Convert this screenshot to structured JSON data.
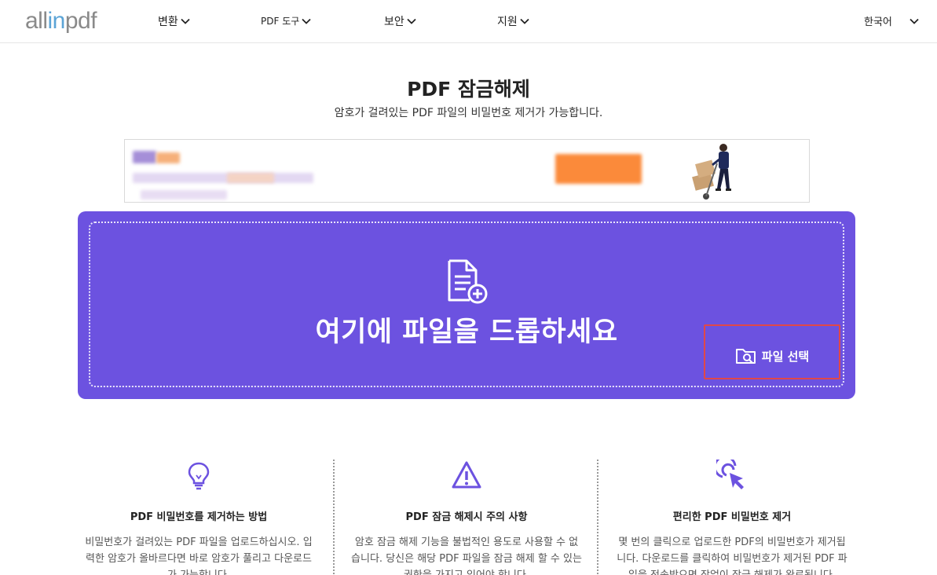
{
  "header": {
    "logo": {
      "pre": "all",
      "mid": "in",
      "post": "pdf"
    },
    "nav": [
      {
        "label": "변환"
      },
      {
        "label": "PDF 도구"
      },
      {
        "label": "보안"
      },
      {
        "label": "지원"
      }
    ],
    "language": "한국어"
  },
  "page": {
    "title": "PDF 잠금해제",
    "subtitle": "암호가 걸려있는 PDF 파일의 비밀번호 제거가 가능합니다."
  },
  "dropzone": {
    "text": "여기에 파일을 드롭하세요",
    "select_label": "파일 선택"
  },
  "features": [
    {
      "icon": "lightbulb-icon",
      "title": "PDF 비밀번호를 제거하는 방법",
      "text": "비밀번호가 걸려있는 PDF 파일을 업로드하십시오. 입력한 암호가 올바르다면 바로 암호가 풀리고 다운로드가 가능합니다."
    },
    {
      "icon": "warning-icon",
      "title": "PDF 잠금 해제시 주의 사항",
      "text": "암호 잠금 해제 기능을 불법적인 용도로 사용할 수 없습니다. 당신은 해당 PDF 파일을 잠금 해제 할 수 있는 권한을 가지고 있어야 합니다."
    },
    {
      "icon": "click-icon",
      "title": "편리한 PDF 비밀번호 제거",
      "text": "몇 번의 클릭으로 업로드한 PDF의 비밀번호가 제거됩니다. 다운로드를 클릭하여 비밀번호가 제거된 PDF 파일을 전송받으면 작업이 잠금 해제가 완료됩니다."
    }
  ],
  "colors": {
    "accent": "#6c52e0",
    "highlight_border": "#e04848",
    "logo_blue": "#5ca4d6"
  }
}
